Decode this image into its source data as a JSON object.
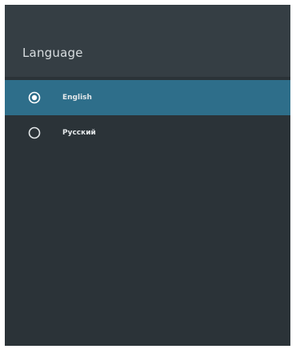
{
  "header": {
    "title": "Language"
  },
  "options": [
    {
      "label": "English",
      "selected": true,
      "radio_icon": "radio-checked-icon"
    },
    {
      "label": "Русский",
      "selected": false,
      "radio_icon": "radio-unchecked-icon"
    }
  ],
  "colors": {
    "panel_background": "#2b3338",
    "header_background": "#353e44",
    "selected_row": "#2e6e8a",
    "text": "#e4e8ea"
  }
}
